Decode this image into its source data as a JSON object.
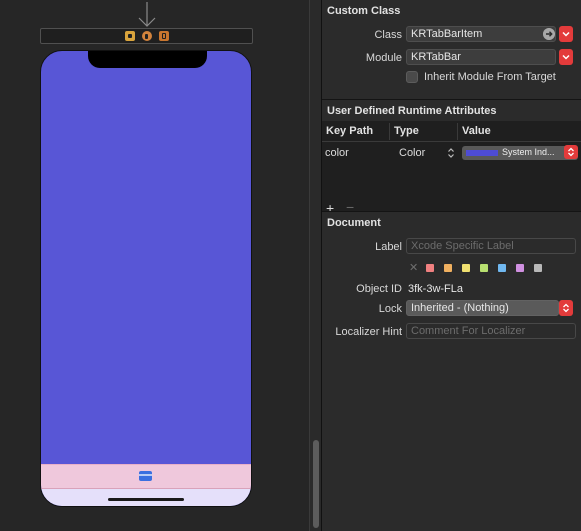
{
  "custom_class": {
    "title": "Custom Class",
    "class_label": "Class",
    "class_value": "KRTabBarItem",
    "module_label": "Module",
    "module_value": "KRTabBar",
    "inherit_label": "Inherit Module From Target"
  },
  "runtime_attributes": {
    "title": "User Defined Runtime Attributes",
    "columns": [
      "Key Path",
      "Type",
      "Value"
    ],
    "rows": [
      {
        "key_path": "color",
        "type": "Color",
        "value": "System Ind..."
      }
    ],
    "add_label": "+",
    "remove_label": "−"
  },
  "document": {
    "title": "Document",
    "label_label": "Label",
    "label_placeholder": "Xcode Specific Label",
    "label_colors": [
      "#f08080",
      "#f0b060",
      "#f0e070",
      "#b8e070",
      "#70b8f0",
      "#d090e0",
      "#b8b8b8"
    ],
    "object_id_label": "Object ID",
    "object_id_value": "3fk-3w-FLa",
    "lock_label": "Lock",
    "lock_value": "Inherited - (Nothing)",
    "localizer_label": "Localizer Hint",
    "localizer_placeholder": "Comment For Localizer"
  },
  "colors": {
    "view_background": "#5856d6",
    "tab_bar_background": "#efc8dc",
    "accent_red": "#e33b3b"
  },
  "icons": [
    "segue-arrow-icon",
    "view-controller-icon",
    "first-responder-icon",
    "exit-icon",
    "tab-bar-item-icon",
    "go-to-class-icon",
    "dropdown-chevron-icon",
    "stepper-icon",
    "clear-color-icon"
  ]
}
